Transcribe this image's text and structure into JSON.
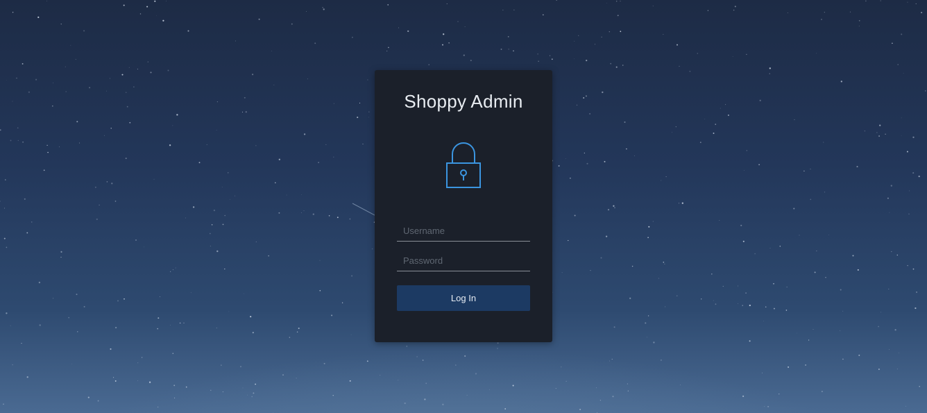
{
  "login": {
    "title": "Shoppy Admin",
    "icon": "lock-icon",
    "username_placeholder": "Username",
    "password_placeholder": "Password",
    "username_value": "",
    "password_value": "",
    "login_label": "Log In"
  },
  "colors": {
    "accent": "#3b95e0",
    "card_background": "#1b202a",
    "button_background": "#1c3a63",
    "page_background": "#23375a"
  }
}
